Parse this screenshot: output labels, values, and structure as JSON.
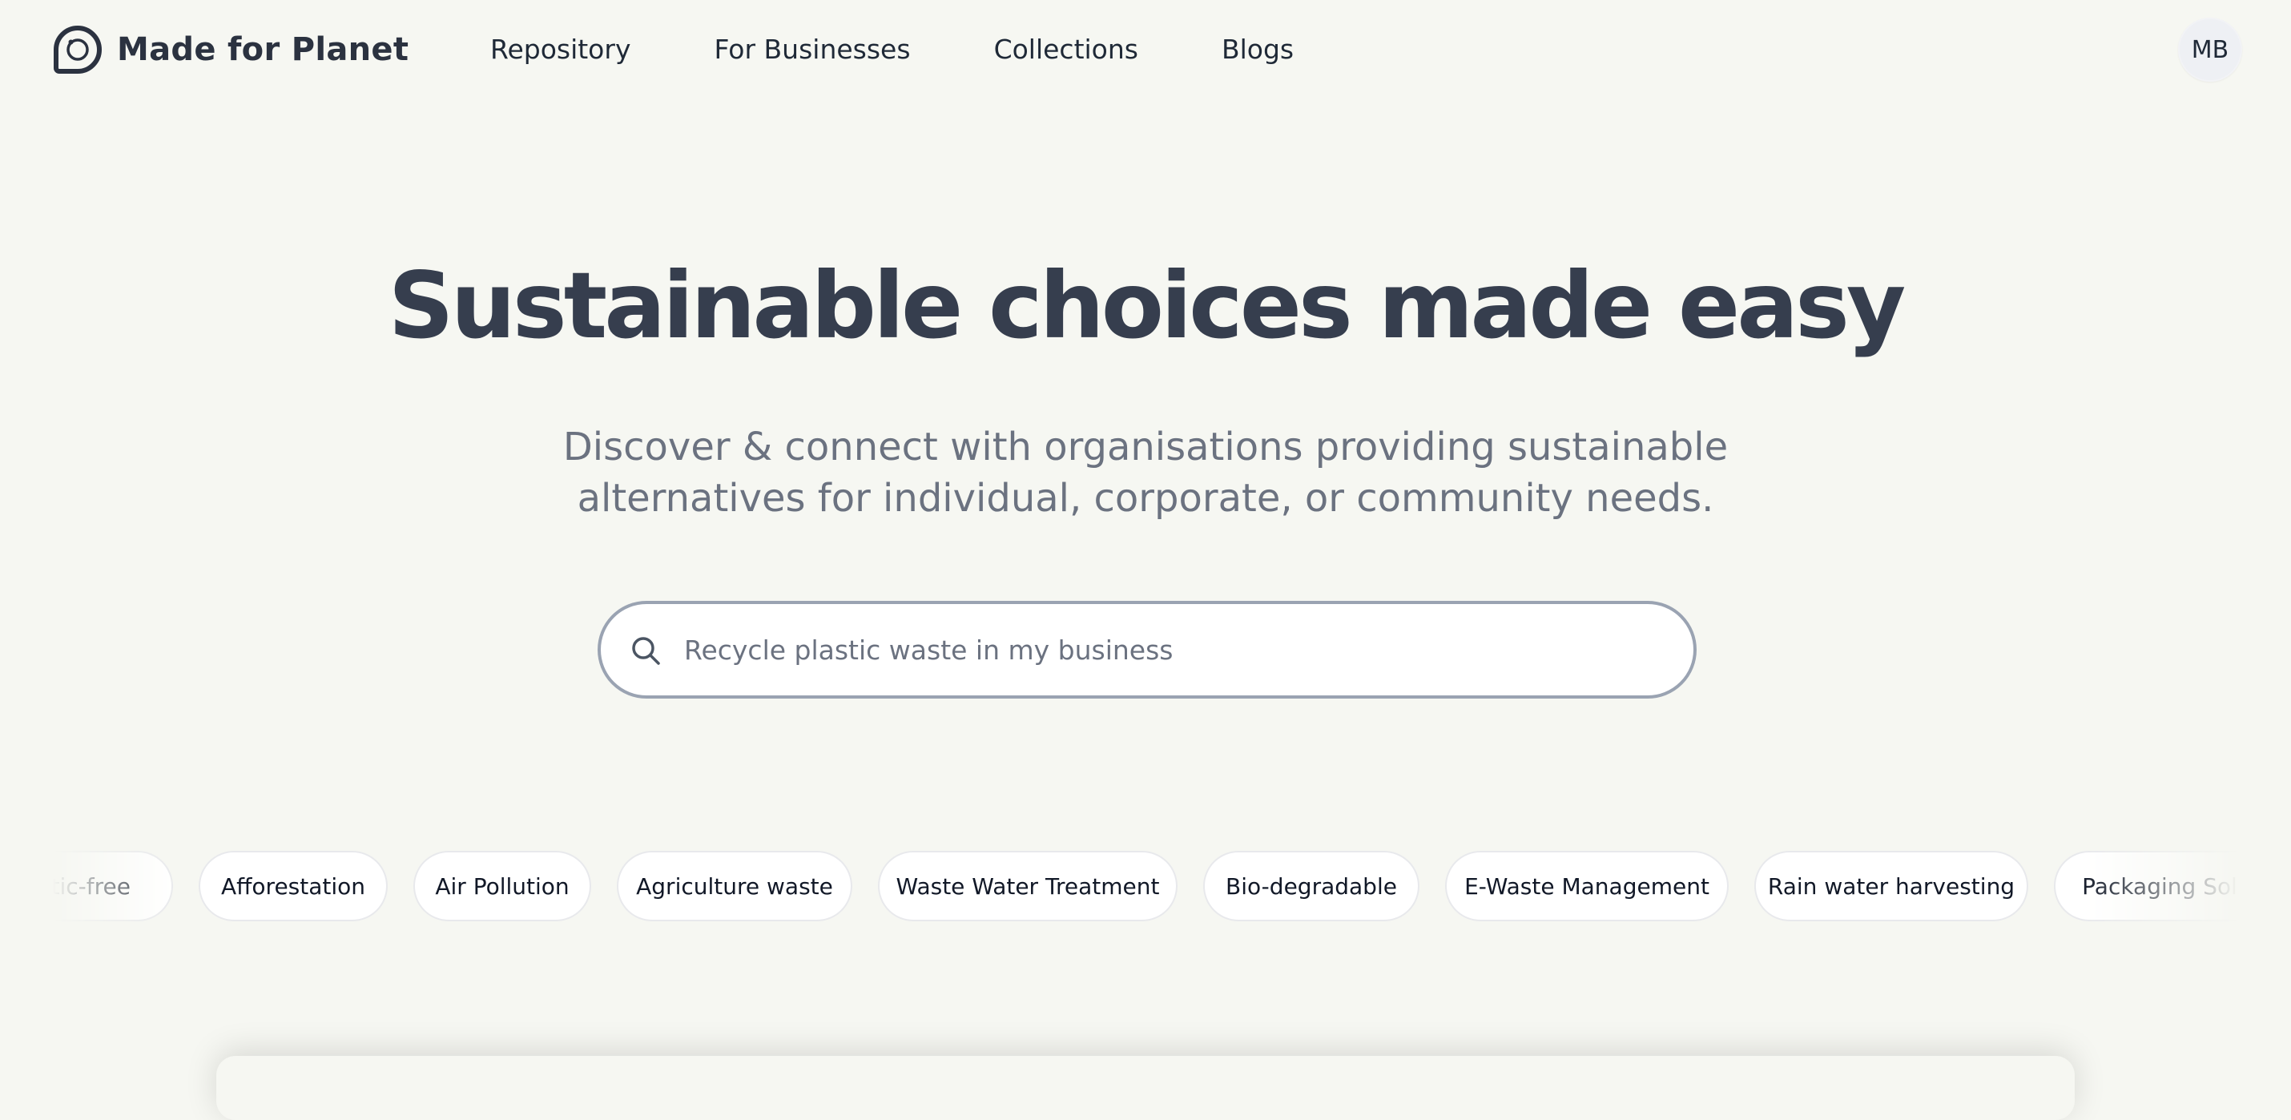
{
  "brand": {
    "name": "Made for Planet"
  },
  "nav": {
    "items": [
      {
        "label": "Repository"
      },
      {
        "label": "For Businesses"
      },
      {
        "label": "Collections"
      },
      {
        "label": "Blogs"
      }
    ]
  },
  "user": {
    "initials": "MB"
  },
  "hero": {
    "title": "Sustainable choices made easy",
    "subtitle_line1": "Discover & connect with organisations providing sustainable",
    "subtitle_line2": "alternatives for individual, corporate, or community needs."
  },
  "search": {
    "placeholder": "Recycle plastic waste in my business",
    "value": ""
  },
  "tags": [
    {
      "label": "Plastic-free"
    },
    {
      "label": "Afforestation"
    },
    {
      "label": "Air Pollution"
    },
    {
      "label": "Agriculture waste"
    },
    {
      "label": "Waste Water Treatment"
    },
    {
      "label": "Bio-degradable"
    },
    {
      "label": "E-Waste Management"
    },
    {
      "label": "Rain water harvesting"
    },
    {
      "label": "Packaging Solutions"
    }
  ],
  "colors": {
    "background": "#f6f7f2",
    "heading": "#363e4e",
    "subtitle": "#6b7280",
    "search_border": "#9aa3b2",
    "tag_background": "#ffffff"
  }
}
